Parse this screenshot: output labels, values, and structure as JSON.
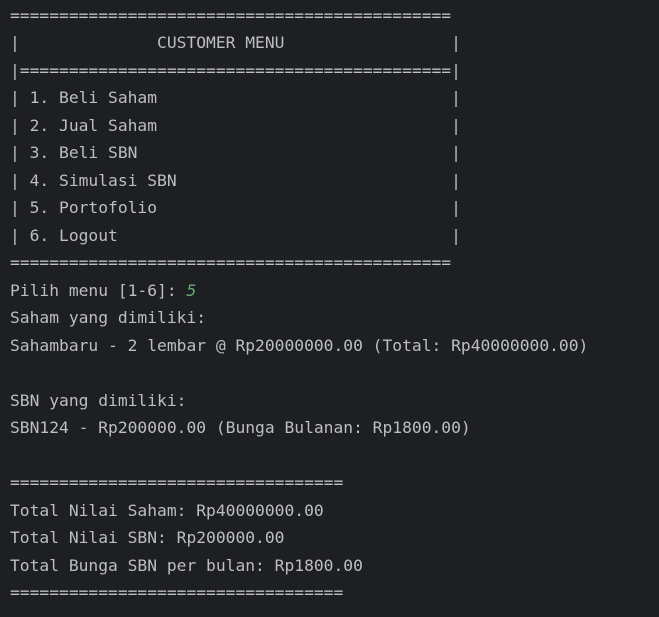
{
  "colors": {
    "background": "#1e1f22",
    "text": "#bcbec4",
    "user_input": "#6aab73"
  },
  "menu": {
    "border_top": "=============================================",
    "title_row": "|              CUSTOMER MENU                 |",
    "separator": "|============================================|",
    "items": [
      "| 1. Beli Saham                              |",
      "| 2. Jual Saham                              |",
      "| 3. Beli SBN                                |",
      "| 4. Simulasi SBN                            |",
      "| 5. Portofolio                              |",
      "| 6. Logout                                  |"
    ],
    "border_bottom": "============================================="
  },
  "prompt": {
    "label": "Pilih menu [1-6]: ",
    "value": "5"
  },
  "portfolio": {
    "saham_heading": "Saham yang dimiliki:",
    "saham_rows": [
      "Sahambaru - 2 lembar @ Rp20000000.00 (Total: Rp40000000.00)"
    ],
    "sbn_heading": "SBN yang dimiliki:",
    "sbn_rows": [
      "SBN124 - Rp200000.00 (Bunga Bulanan: Rp1800.00)"
    ],
    "summary_border_top": "==================================",
    "total_saham": "Total Nilai Saham: Rp40000000.00",
    "total_sbn": "Total Nilai SBN: Rp200000.00",
    "total_bunga": "Total Bunga SBN per bulan: Rp1800.00",
    "summary_border_bottom": "=================================="
  }
}
